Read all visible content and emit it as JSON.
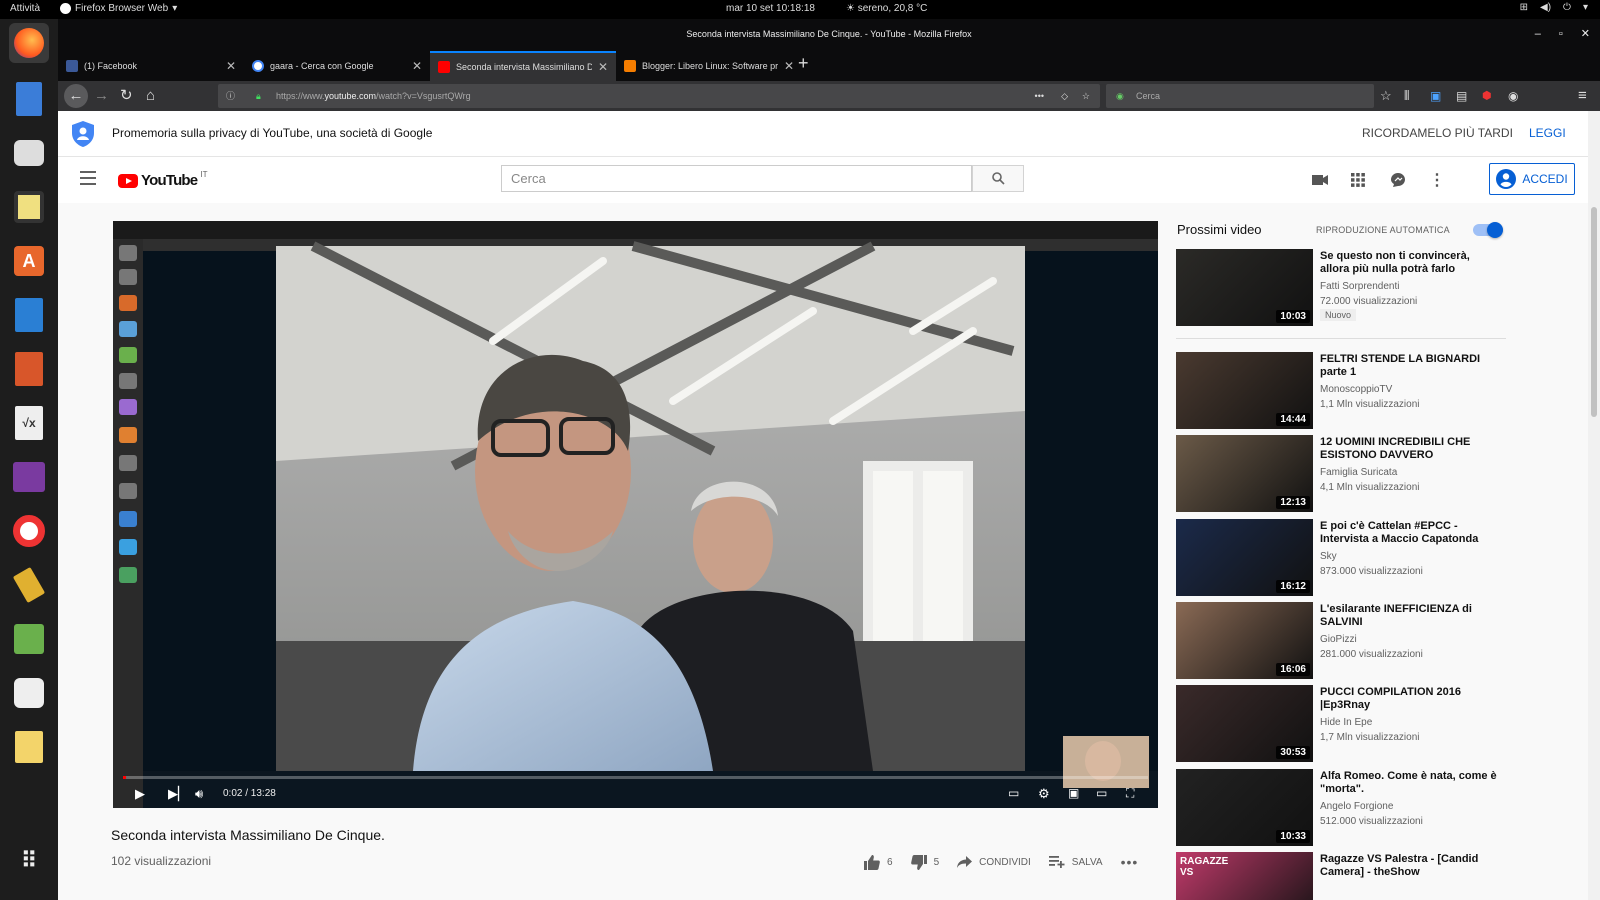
{
  "topbar": {
    "activities": "Attività",
    "app_name": "Firefox Browser Web",
    "datetime": "mar 10 set  10:18:18",
    "weather": "sereno, 20,8 °C"
  },
  "firefox": {
    "window_title": "Seconda intervista Massimiliano De Cinque. - YouTube - Mozilla Firefox",
    "tabs": [
      {
        "title": "(1) Facebook"
      },
      {
        "title": "gaara - Cerca con Google"
      },
      {
        "title": "Seconda intervista Massimiliano De Cinque"
      },
      {
        "title": "Blogger: Libero Linux: Software pro"
      }
    ],
    "url_prefix": "https://www.",
    "url_host": "youtube.com",
    "url_path": "/watch?v=VsgusrtQWrg",
    "search_placeholder": "Cerca"
  },
  "privacy_banner": {
    "text": "Promemoria sulla privacy di YouTube, una società di Google",
    "later": "RICORDAMELO PIÙ TARDI",
    "read": "LEGGI"
  },
  "masthead": {
    "logo": "YouTube",
    "logo_region": "IT",
    "search_placeholder": "Cerca",
    "signin": "ACCEDI"
  },
  "player": {
    "time": "0:02 / 13:28",
    "progress": 0.0025
  },
  "video": {
    "title": "Seconda intervista Massimiliano De Cinque.",
    "views": "102 visualizzazioni",
    "likes": "6",
    "dislikes": "5",
    "share": "CONDIVIDI",
    "save": "SALVA"
  },
  "sidebar": {
    "upnext": "Prossimi video",
    "autoplay": "RIPRODUZIONE AUTOMATICA",
    "items": [
      {
        "title": "Se questo non ti convincerà, allora più nulla potrà farlo",
        "channel": "Fatti Sorprendenti",
        "views": "72.000 visualizzazioni",
        "badge": "Nuovo",
        "duration": "10:03",
        "color": "#2b2a27"
      },
      {
        "title": "FELTRI STENDE LA BIGNARDI parte 1",
        "channel": "MonoscoppioTV",
        "views": "1,1 Mln visualizzazioni",
        "duration": "14:44",
        "color": "#4a3a30"
      },
      {
        "title": "12 UOMINI INCREDIBILI CHE ESISTONO DAVVERO",
        "channel": "Famiglia Suricata",
        "views": "4,1 Mln visualizzazioni",
        "duration": "12:13",
        "color": "#6b5a48"
      },
      {
        "title": "E poi c'è Cattelan #EPCC - Intervista a Maccio Capatonda",
        "channel": "Sky",
        "views": "873.000 visualizzazioni",
        "duration": "16:12",
        "color": "#1b2a4a"
      },
      {
        "title": "L'esilarante INEFFICIENZA di SALVINI",
        "channel": "GioPizzi",
        "views": "281.000 visualizzazioni",
        "duration": "16:06",
        "color": "#8a6a55"
      },
      {
        "title": "PUCCI COMPILATION 2016 |Ep3Rnay",
        "channel": "Hide In Epe",
        "views": "1,7 Mln visualizzazioni",
        "duration": "30:53",
        "color": "#3a2a2a"
      },
      {
        "title": "Alfa Romeo. Come è nata, come è \"morta\".",
        "channel": "Angelo Forgione",
        "views": "512.000 visualizzazioni",
        "duration": "10:33",
        "color": "#222222"
      },
      {
        "title": "Ragazze VS Palestra - [Candid Camera] - theShow",
        "channel": "",
        "views": "",
        "duration": "",
        "color": "#c03a6a",
        "thumb_text": "RAGAZZE VS"
      }
    ]
  }
}
